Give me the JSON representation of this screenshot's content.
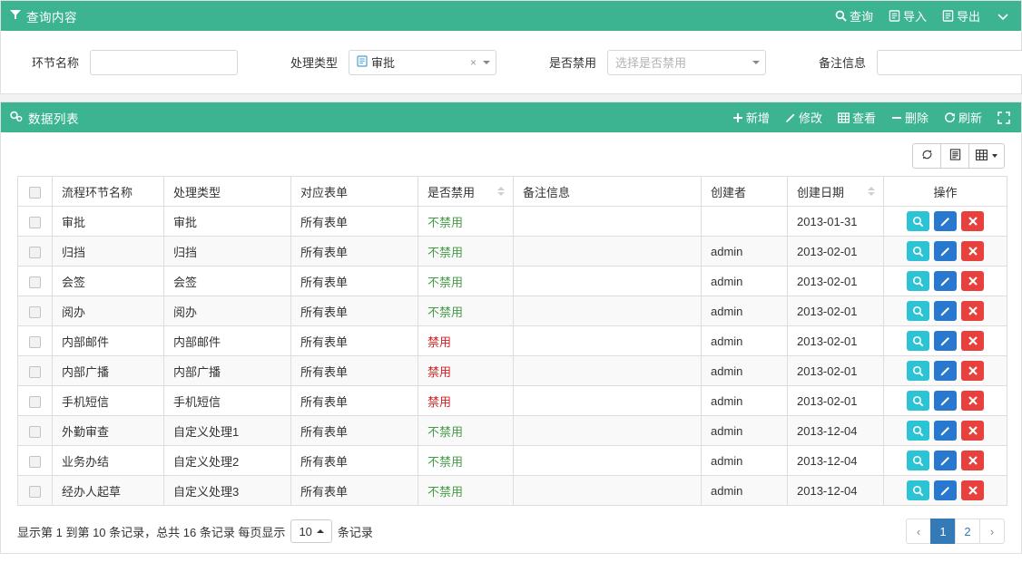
{
  "query_panel": {
    "title": "查询内容",
    "icon": "filter-icon",
    "actions": [
      {
        "label": "查询",
        "icon": "search-icon"
      },
      {
        "label": "导入",
        "icon": "import-icon"
      },
      {
        "label": "导出",
        "icon": "export-icon"
      }
    ],
    "collapse_icon": "chevron-down-icon",
    "fields": [
      {
        "label": "环节名称",
        "type": "text",
        "value": "",
        "placeholder": ""
      },
      {
        "label": "处理类型",
        "type": "select2",
        "value": "审批",
        "placeholder": "",
        "clear": "×"
      },
      {
        "label": "是否禁用",
        "type": "select",
        "value": "",
        "placeholder": "选择是否禁用"
      },
      {
        "label": "备注信息",
        "type": "text",
        "value": "",
        "placeholder": ""
      }
    ]
  },
  "list_panel": {
    "title": "数据列表",
    "icon": "gears-icon",
    "actions": [
      {
        "label": "新增",
        "icon": "plus-icon"
      },
      {
        "label": "修改",
        "icon": "pencil-icon"
      },
      {
        "label": "查看",
        "icon": "table-icon"
      },
      {
        "label": "删除",
        "icon": "minus-icon"
      },
      {
        "label": "刷新",
        "icon": "refresh-icon"
      }
    ],
    "fullscreen_icon": "expand-icon",
    "table_toolbar": [
      {
        "name": "refresh",
        "icon": "refresh-icon"
      },
      {
        "name": "toggle",
        "icon": "list-icon"
      },
      {
        "name": "columns",
        "icon": "grid-icon",
        "caret": true
      }
    ]
  },
  "table": {
    "columns": [
      {
        "label": "",
        "key": "checkbox",
        "sortable": false
      },
      {
        "label": "流程环节名称",
        "key": "name",
        "sortable": false
      },
      {
        "label": "处理类型",
        "key": "type",
        "sortable": false
      },
      {
        "label": "对应表单",
        "key": "form",
        "sortable": false
      },
      {
        "label": "是否禁用",
        "key": "disabled",
        "sortable": true
      },
      {
        "label": "备注信息",
        "key": "memo",
        "sortable": false
      },
      {
        "label": "创建者",
        "key": "creator",
        "sortable": false
      },
      {
        "label": "创建日期",
        "key": "created",
        "sortable": true
      },
      {
        "label": "操作",
        "key": "ops",
        "sortable": false
      }
    ],
    "rows": [
      {
        "name": "审批",
        "type": "审批",
        "form": "所有表单",
        "disabled": "不禁用",
        "disabled_state": "ok",
        "memo": "",
        "creator": "",
        "created": "2013-01-31"
      },
      {
        "name": "归挡",
        "type": "归挡",
        "form": "所有表单",
        "disabled": "不禁用",
        "disabled_state": "ok",
        "memo": "",
        "creator": "admin",
        "created": "2013-02-01"
      },
      {
        "name": "会签",
        "type": "会签",
        "form": "所有表单",
        "disabled": "不禁用",
        "disabled_state": "ok",
        "memo": "",
        "creator": "admin",
        "created": "2013-02-01"
      },
      {
        "name": "阅办",
        "type": "阅办",
        "form": "所有表单",
        "disabled": "不禁用",
        "disabled_state": "ok",
        "memo": "",
        "creator": "admin",
        "created": "2013-02-01"
      },
      {
        "name": "内部邮件",
        "type": "内部邮件",
        "form": "所有表单",
        "disabled": "禁用",
        "disabled_state": "no",
        "memo": "",
        "creator": "admin",
        "created": "2013-02-01"
      },
      {
        "name": "内部广播",
        "type": "内部广播",
        "form": "所有表单",
        "disabled": "禁用",
        "disabled_state": "no",
        "memo": "",
        "creator": "admin",
        "created": "2013-02-01"
      },
      {
        "name": "手机短信",
        "type": "手机短信",
        "form": "所有表单",
        "disabled": "禁用",
        "disabled_state": "no",
        "memo": "",
        "creator": "admin",
        "created": "2013-02-01"
      },
      {
        "name": "外勤审查",
        "type": "自定义处理1",
        "form": "所有表单",
        "disabled": "不禁用",
        "disabled_state": "ok",
        "memo": "",
        "creator": "admin",
        "created": "2013-12-04"
      },
      {
        "name": "业务办结",
        "type": "自定义处理2",
        "form": "所有表单",
        "disabled": "不禁用",
        "disabled_state": "ok",
        "memo": "",
        "creator": "admin",
        "created": "2013-12-04"
      },
      {
        "name": "经办人起草",
        "type": "自定义处理3",
        "form": "所有表单",
        "disabled": "不禁用",
        "disabled_state": "ok",
        "memo": "",
        "creator": "admin",
        "created": "2013-12-04"
      }
    ],
    "row_ops": [
      {
        "name": "view",
        "icon": "search-icon"
      },
      {
        "name": "edit",
        "icon": "pencil-icon"
      },
      {
        "name": "delete",
        "icon": "times-icon"
      }
    ]
  },
  "footer": {
    "info_prefix": "显示第 1 到第 10 条记录，总共 16 条记录 每页显示",
    "page_size": "10",
    "info_suffix": "条记录",
    "pagination": {
      "prev": "‹",
      "pages": [
        "1",
        "2"
      ],
      "active": "1",
      "next": "›"
    }
  },
  "colors": {
    "header_green": "#3cb491",
    "state_ok": "#449d44",
    "state_no": "#d9201f",
    "active_page": "#337ab7",
    "op_view": "#2cc3d5",
    "op_edit": "#2878d0",
    "op_delete": "#e8403c"
  }
}
